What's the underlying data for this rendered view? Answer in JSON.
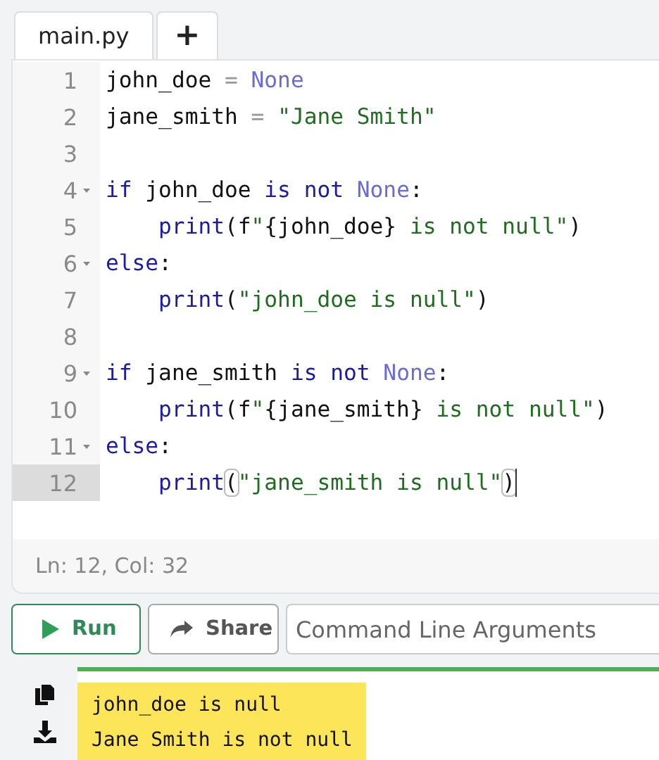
{
  "tabs": [
    {
      "label": "main.py",
      "kind": "file"
    },
    {
      "label": "+",
      "kind": "add"
    }
  ],
  "editor": {
    "lines": [
      {
        "number": "1",
        "foldable": false,
        "indented": false,
        "active": false,
        "tokens": [
          {
            "text": "john_doe",
            "kind": "plain"
          },
          {
            "text": " = ",
            "kind": "op"
          },
          {
            "text": "None",
            "kind": "constant"
          }
        ]
      },
      {
        "number": "2",
        "foldable": false,
        "indented": false,
        "active": false,
        "tokens": [
          {
            "text": "jane_smith",
            "kind": "plain"
          },
          {
            "text": " = ",
            "kind": "op"
          },
          {
            "text": "\"Jane Smith\"",
            "kind": "string"
          }
        ]
      },
      {
        "number": "3",
        "foldable": false,
        "active": false
      },
      {
        "number": "4",
        "foldable": true,
        "indented": false,
        "active": false,
        "tokens": [
          {
            "text": "if",
            "kind": "keyword"
          },
          {
            "text": " john_doe ",
            "kind": "plain"
          },
          {
            "text": "is not",
            "kind": "keyword"
          },
          {
            "text": " None",
            "kind": "constant"
          },
          {
            "text": ":",
            "kind": "plain"
          }
        ]
      },
      {
        "number": "5",
        "foldable": false,
        "indented": true,
        "active": false,
        "tokens": [
          {
            "text": "print",
            "kind": "keyword"
          },
          {
            "text": "(f",
            "kind": "plain"
          },
          {
            "text": "\"",
            "kind": "string"
          },
          {
            "text": "{john_doe}",
            "kind": "plain"
          },
          {
            "text": " is not null\"",
            "kind": "string"
          },
          {
            "text": ")",
            "kind": "plain"
          }
        ]
      },
      {
        "number": "6",
        "foldable": true,
        "indented": false,
        "active": false,
        "tokens": [
          {
            "text": "else",
            "kind": "keyword"
          },
          {
            "text": ":",
            "kind": "plain"
          }
        ]
      },
      {
        "number": "7",
        "foldable": false,
        "indented": true,
        "active": false,
        "tokens": [
          {
            "text": "print",
            "kind": "keyword"
          },
          {
            "text": "(",
            "kind": "plain"
          },
          {
            "text": "\"john_doe is null\"",
            "kind": "string"
          },
          {
            "text": ")",
            "kind": "plain"
          }
        ]
      },
      {
        "number": "8",
        "foldable": false,
        "active": false
      },
      {
        "number": "9",
        "foldable": true,
        "indented": false,
        "active": false,
        "tokens": [
          {
            "text": "if",
            "kind": "keyword"
          },
          {
            "text": " jane_smith ",
            "kind": "plain"
          },
          {
            "text": "is not",
            "kind": "keyword"
          },
          {
            "text": " None",
            "kind": "constant"
          },
          {
            "text": ":",
            "kind": "plain"
          }
        ]
      },
      {
        "number": "10",
        "foldable": false,
        "indented": true,
        "active": false,
        "tokens": [
          {
            "text": "print",
            "kind": "keyword"
          },
          {
            "text": "(f",
            "kind": "plain"
          },
          {
            "text": "\"",
            "kind": "string"
          },
          {
            "text": "{jane_smith}",
            "kind": "plain"
          },
          {
            "text": " is not null\"",
            "kind": "string"
          },
          {
            "text": ")",
            "kind": "plain"
          }
        ]
      },
      {
        "number": "11",
        "foldable": true,
        "indented": false,
        "active": false,
        "tokens": [
          {
            "text": "else",
            "kind": "keyword"
          },
          {
            "text": ":",
            "kind": "plain"
          }
        ]
      },
      {
        "number": "12",
        "foldable": false,
        "indented": true,
        "active": true,
        "tokens": [
          {
            "text": "print",
            "kind": "keyword"
          },
          {
            "text": "(",
            "kind": "bracket-match"
          },
          {
            "text": "\"jane_smith is null\"",
            "kind": "string"
          },
          {
            "text": ")",
            "kind": "bracket-match"
          }
        ]
      }
    ]
  },
  "status_bar": "Ln: 12,  Col: 32",
  "toolbar": {
    "run_label": "Run",
    "share_label": "Share",
    "arguments_placeholder": "Command Line Arguments"
  },
  "output": {
    "highlighted": true,
    "lines": [
      "john_doe is null",
      "Jane Smith is not null"
    ]
  }
}
